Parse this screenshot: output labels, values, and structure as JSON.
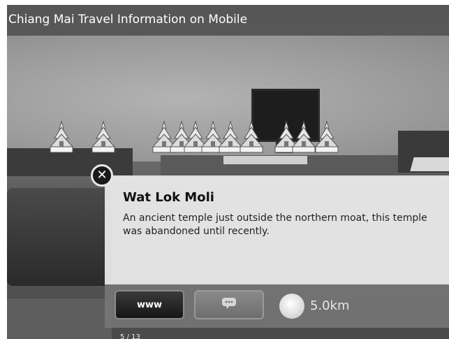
{
  "app": {
    "title": "Chiang Mai Travel Information on Mobile"
  },
  "markers": {
    "count": 11,
    "icon": "temple-marker-icon"
  },
  "popup": {
    "close_icon": "close-icon",
    "title": "Wat Lok Moli",
    "description": "An ancient temple just outside the northern moat, this temple was abandoned until recently.",
    "www_label": "www",
    "comment_icon": "speech-bubble-icon",
    "distance": "5.0km",
    "pager": "5 / 13"
  },
  "colors": {
    "titlebar": "#282828",
    "card_bg": "#eeeeee",
    "actions_bg": "#787878"
  }
}
